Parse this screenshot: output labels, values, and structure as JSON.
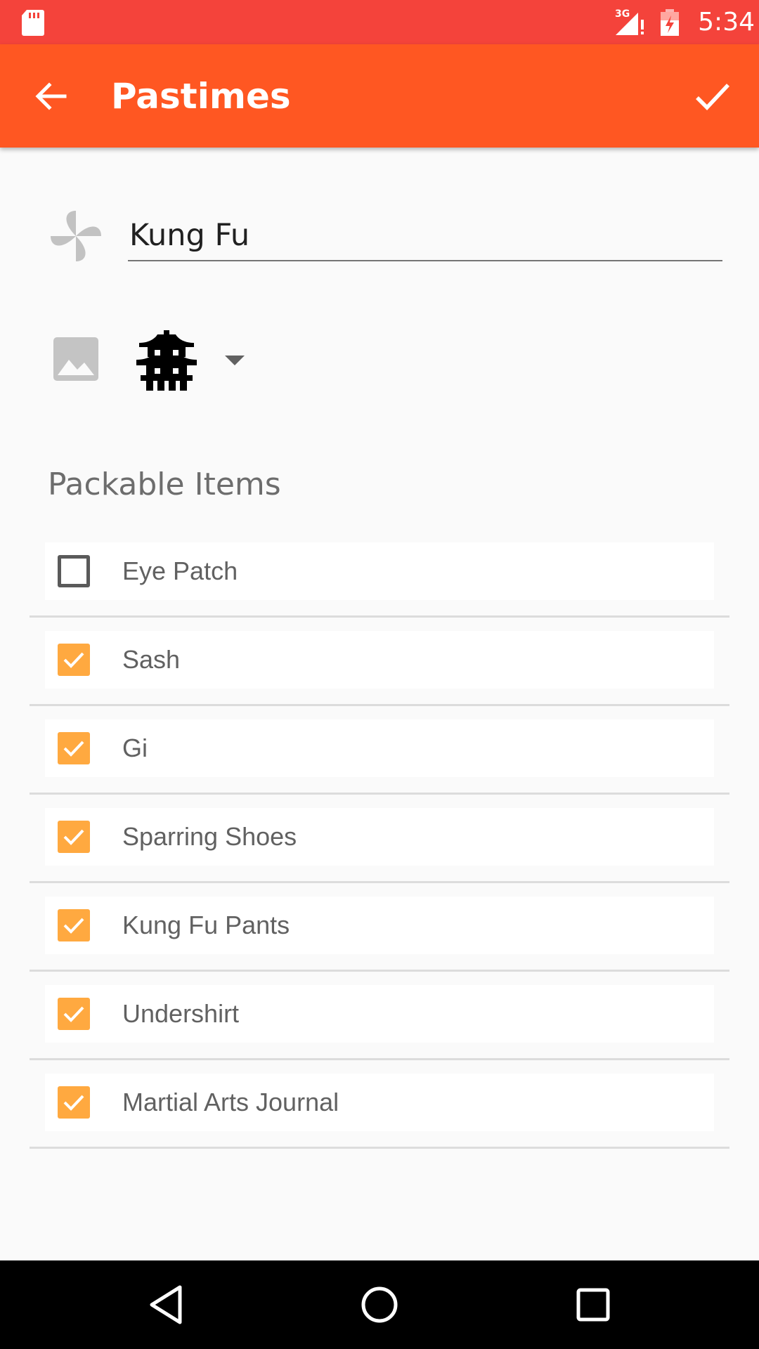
{
  "status_bar": {
    "time": "5:34",
    "network": "3G",
    "icons": [
      "sd-card-icon",
      "signal-3g-icon",
      "battery-charging-icon"
    ],
    "color": "#f4433b"
  },
  "app_bar": {
    "title": "Pastimes",
    "color": "#ff5722",
    "back_icon": "arrow-left-icon",
    "save_icon": "check-icon"
  },
  "pastime": {
    "name_value": "Kung Fu",
    "name_icon": "pinwheel-icon",
    "image_icon": "image-icon",
    "selected_icon": "pagoda-icon"
  },
  "packable": {
    "heading": "Packable Items",
    "check_color": "#ffa940",
    "items": [
      {
        "label": "Eye Patch",
        "checked": false
      },
      {
        "label": "Sash",
        "checked": true
      },
      {
        "label": "Gi",
        "checked": true
      },
      {
        "label": "Sparring Shoes",
        "checked": true
      },
      {
        "label": "Kung Fu Pants",
        "checked": true
      },
      {
        "label": "Undershirt",
        "checked": true
      },
      {
        "label": "Martial Arts Journal",
        "checked": true
      }
    ]
  },
  "nav_bar": {
    "icons": [
      "nav-back-icon",
      "nav-home-icon",
      "nav-recents-icon"
    ]
  }
}
